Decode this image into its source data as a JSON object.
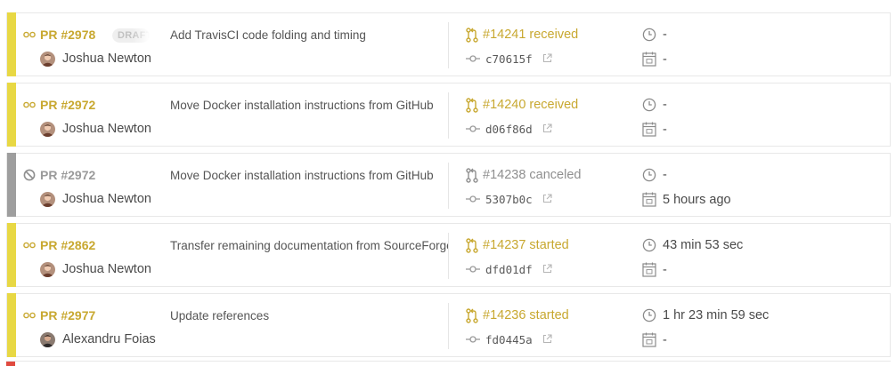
{
  "colors": {
    "started": "#e8d844",
    "canceled": "#9e9e9e",
    "accent_text": "#c8a830",
    "failed_edge": "#e04a3f"
  },
  "builds": [
    {
      "state": "started",
      "pr_number": "PR #2978",
      "draft": "DRAFT",
      "title": "Add TravisCI code folding and timing",
      "author": "Joshua Newton",
      "avatar": "joshua-avatar",
      "build_label": "#14241 received",
      "commit": "c70615f",
      "duration": "-",
      "finished": "-"
    },
    {
      "state": "started",
      "pr_number": "PR #2972",
      "draft": "",
      "title": "Move Docker installation instructions from GitHub",
      "author": "Joshua Newton",
      "avatar": "joshua-avatar",
      "build_label": "#14240 received",
      "commit": "d06f86d",
      "duration": "-",
      "finished": "-"
    },
    {
      "state": "canceled",
      "pr_number": "PR #2972",
      "draft": "",
      "title": "Move Docker installation instructions from GitHub",
      "author": "Joshua Newton",
      "avatar": "joshua-avatar",
      "build_label": "#14238 canceled",
      "commit": "5307b0c",
      "duration": "-",
      "finished": "5 hours ago"
    },
    {
      "state": "started",
      "pr_number": "PR #2862",
      "draft": "",
      "title": "Transfer remaining documentation from SourceForge",
      "author": "Joshua Newton",
      "avatar": "joshua-avatar",
      "build_label": "#14237 started",
      "commit": "dfd01df",
      "duration": "43 min 53 sec",
      "finished": "-"
    },
    {
      "state": "started",
      "pr_number": "PR #2977",
      "draft": "",
      "title": "Update references",
      "author": "Alexandru Foias",
      "avatar": "alexandru-avatar",
      "build_label": "#14236 started",
      "commit": "fd0445a",
      "duration": "1 hr 23 min 59 sec",
      "finished": "-"
    }
  ]
}
